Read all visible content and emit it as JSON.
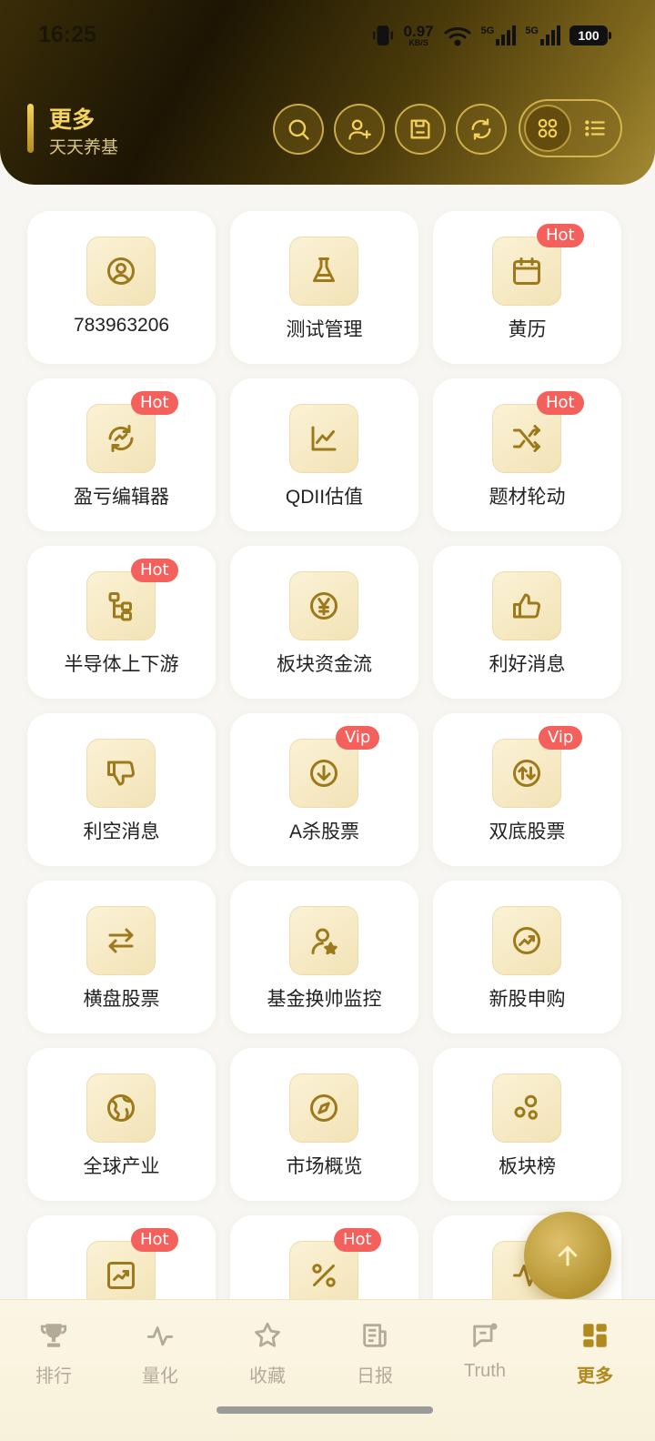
{
  "status_bar": {
    "time": "16:25",
    "speed_value": "0.97",
    "speed_unit": "KB/S",
    "signal_1": "5G",
    "signal_2": "5G",
    "battery": "100"
  },
  "header": {
    "title": "更多",
    "subtitle": "天天养基"
  },
  "header_buttons": [
    {
      "name": "search-button",
      "icon": "search-icon"
    },
    {
      "name": "add-user-button",
      "icon": "user-plus-icon"
    },
    {
      "name": "save-button",
      "icon": "save-icon"
    },
    {
      "name": "refresh-button",
      "icon": "refresh-icon"
    }
  ],
  "view_toggle": {
    "grid_icon": "grid-icon",
    "list_icon": "list-icon",
    "active": "grid"
  },
  "cards": [
    {
      "label": "783963206",
      "icon": "user-circle-icon",
      "badge": ""
    },
    {
      "label": "测试管理",
      "icon": "flask-icon",
      "badge": ""
    },
    {
      "label": "黄历",
      "icon": "calendar-icon",
      "badge": "Hot"
    },
    {
      "label": "盈亏编辑器",
      "icon": "chart-cycle-icon",
      "badge": "Hot"
    },
    {
      "label": "QDII估值",
      "icon": "line-chart-icon",
      "badge": ""
    },
    {
      "label": "题材轮动",
      "icon": "shuffle-icon",
      "badge": "Hot"
    },
    {
      "label": "半导体上下游",
      "icon": "hierarchy-icon",
      "badge": "Hot"
    },
    {
      "label": "板块资金流",
      "icon": "yen-icon",
      "badge": ""
    },
    {
      "label": "利好消息",
      "icon": "thumbs-up-icon",
      "badge": ""
    },
    {
      "label": "利空消息",
      "icon": "thumbs-down-icon",
      "badge": ""
    },
    {
      "label": "A杀股票",
      "icon": "arrow-down-circle-icon",
      "badge": "Vip"
    },
    {
      "label": "双底股票",
      "icon": "arrows-up-down-circle-icon",
      "badge": "Vip"
    },
    {
      "label": "横盘股票",
      "icon": "arrows-left-right-icon",
      "badge": ""
    },
    {
      "label": "基金换帅监控",
      "icon": "user-star-icon",
      "badge": ""
    },
    {
      "label": "新股申购",
      "icon": "trend-circle-icon",
      "badge": ""
    },
    {
      "label": "全球产业",
      "icon": "globe-icon",
      "badge": ""
    },
    {
      "label": "市场概览",
      "icon": "compass-icon",
      "badge": ""
    },
    {
      "label": "板块榜",
      "icon": "bubbles-icon",
      "badge": ""
    },
    {
      "label": "",
      "icon": "chart-box-icon",
      "badge": "Hot"
    },
    {
      "label": "",
      "icon": "percent-icon",
      "badge": "Hot"
    },
    {
      "label": "",
      "icon": "pulse-icon",
      "badge": ""
    }
  ],
  "fab": {
    "icon": "arrow-up-icon"
  },
  "bottom_nav": [
    {
      "label": "排行",
      "icon": "trophy-icon",
      "active": false
    },
    {
      "label": "量化",
      "icon": "pulse-icon",
      "active": false
    },
    {
      "label": "收藏",
      "icon": "star-icon",
      "active": false
    },
    {
      "label": "日报",
      "icon": "newspaper-icon",
      "active": false
    },
    {
      "label": "Truth",
      "icon": "chat-icon",
      "active": false
    },
    {
      "label": "更多",
      "icon": "dashboard-icon",
      "active": true
    }
  ],
  "colors": {
    "gold": "#9c7a1c",
    "badge": "#f4605b",
    "active_nav": "#b08a1e",
    "inactive_nav": "#b3ab98"
  }
}
